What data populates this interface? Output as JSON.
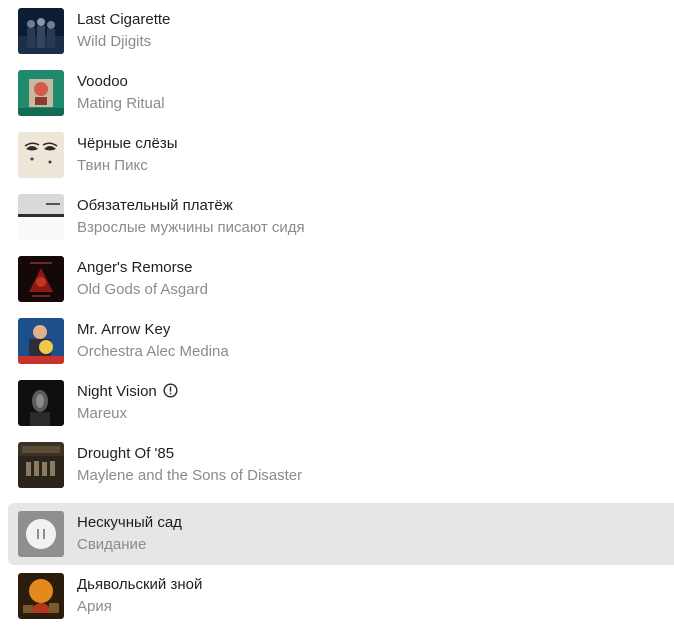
{
  "tracks": [
    {
      "title": "Last Cigarette",
      "artist": "Wild Djigits",
      "cover_icon": "album-cover"
    },
    {
      "title": "Voodoo",
      "artist": "Mating Ritual",
      "cover_icon": "album-cover"
    },
    {
      "title": "Чёрные слёзы",
      "artist": "Твин Пикс",
      "cover_icon": "album-cover"
    },
    {
      "title": "Обязательный платёж",
      "artist": "Взрослые мужчины писают сидя",
      "cover_icon": "album-cover"
    },
    {
      "title": "Anger's Remorse",
      "artist": "Old Gods of Asgard",
      "cover_icon": "album-cover"
    },
    {
      "title": "Mr. Arrow Key",
      "artist": "Orchestra Alec Medina",
      "cover_icon": "album-cover"
    },
    {
      "title": "Night Vision",
      "artist": "Mareux",
      "cover_icon": "album-cover",
      "badge_icon": "info-icon"
    },
    {
      "title": "Drought Of '85",
      "artist": "Maylene and the Sons of Disaster",
      "cover_icon": "album-cover"
    },
    {
      "title": "Нескучный сад",
      "artist": "Свидание",
      "cover_icon": "pause-icon",
      "state": "playing"
    },
    {
      "title": "Дьявольский зной",
      "artist": "Ария",
      "cover_icon": "album-cover"
    }
  ],
  "colors": {
    "title": "#1f1f1f",
    "artist": "#8b8b8b",
    "active_row_bg": "#e6e6e6",
    "pause_overlay": "#8f8f8f"
  }
}
